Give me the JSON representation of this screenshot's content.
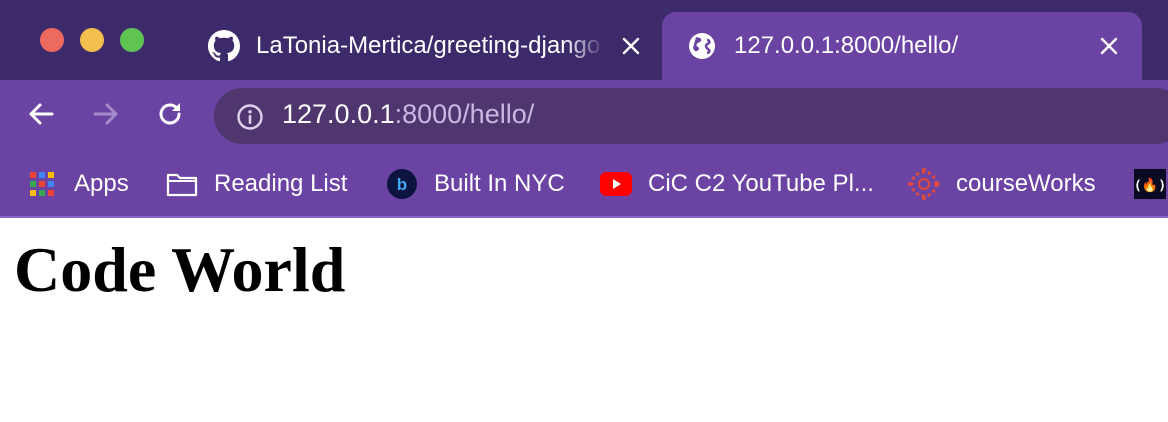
{
  "window": {
    "traffic_lights": [
      "close",
      "minimize",
      "zoom"
    ],
    "colors": {
      "frame": "#3d2a6b",
      "toolbar": "#6b43a3",
      "omnibox": "#50366f",
      "close": "#ec6a5e",
      "minimize": "#f4bf4f",
      "zoom": "#61c554"
    }
  },
  "tabs": [
    {
      "icon": "github-icon",
      "title": "LaTonia-Mertica/greeting-django",
      "active": false
    },
    {
      "icon": "globe-icon",
      "title": "127.0.0.1:8000/hello/",
      "active": true
    }
  ],
  "toolbar": {
    "back_icon": "arrow-left-icon",
    "forward_icon": "arrow-right-icon",
    "reload_icon": "reload-icon",
    "url_host": "127.0.0.1",
    "url_rest": ":8000/hello/"
  },
  "bookmarks": [
    {
      "icon": "apps-grid-icon",
      "label": "Apps"
    },
    {
      "icon": "folder-icon",
      "label": "Reading List"
    },
    {
      "icon": "builtin-logo-icon",
      "label": "Built In NYC"
    },
    {
      "icon": "youtube-icon",
      "label": "CiC C2 YouTube Pl..."
    },
    {
      "icon": "canvas-logo-icon",
      "label": "courseWorks"
    },
    {
      "icon": "freecodecamp-icon",
      "label": ""
    }
  ],
  "page": {
    "heading": "Code World"
  }
}
